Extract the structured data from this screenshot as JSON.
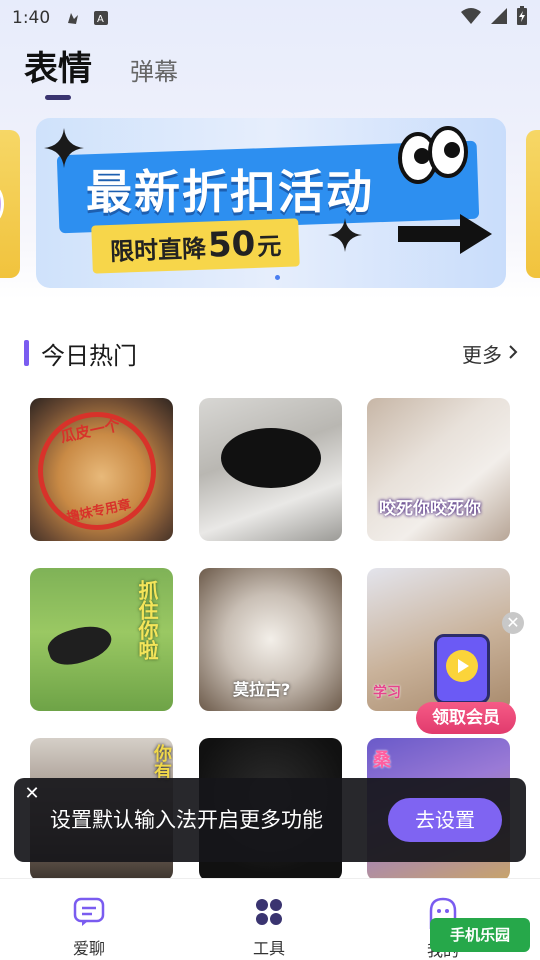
{
  "status_bar": {
    "time": "1:40",
    "icons": [
      "notification-app-icon",
      "keyboard-a-icon",
      "wifi-icon",
      "signal-icon",
      "battery-charging-icon"
    ]
  },
  "tabs": [
    {
      "label": "表情",
      "active": true
    },
    {
      "label": "弹幕",
      "active": false
    }
  ],
  "banner": {
    "title": "最新折扣活动",
    "subtitle_prefix": "限时直降",
    "amount": "50",
    "unit": "元",
    "page_index": 1,
    "page_count": 3
  },
  "section": {
    "title": "今日热门",
    "more_label": "更多"
  },
  "stickers": [
    {
      "caption": "",
      "stamp_top": "瓜皮一个",
      "stamp_bottom": "撸妹专用章"
    },
    {
      "caption": ""
    },
    {
      "caption": "咬死你咬死你"
    },
    {
      "caption": "抓住你啦"
    },
    {
      "caption": "莫拉古?"
    },
    {
      "caption": "学习"
    },
    {
      "caption": "你有"
    },
    {
      "caption": ""
    },
    {
      "caption": "桑"
    }
  ],
  "promo": {
    "label": "领取会员"
  },
  "snackbar": {
    "message": "设置默认输入法开启更多功能",
    "action": "去设置"
  },
  "bottom_nav": [
    {
      "label": "爱聊",
      "icon": "chat-icon",
      "active": false
    },
    {
      "label": "工具",
      "icon": "grid-icon",
      "active": true
    },
    {
      "label": "我的",
      "icon": "ghost-icon",
      "active": false
    }
  ],
  "watermark": {
    "text": "手机乐园"
  },
  "colors": {
    "accent": "#7f64f2",
    "tab_indicator": "#3a3470",
    "section_bar": "#7a5cf0",
    "promo": "#e13b6d"
  }
}
